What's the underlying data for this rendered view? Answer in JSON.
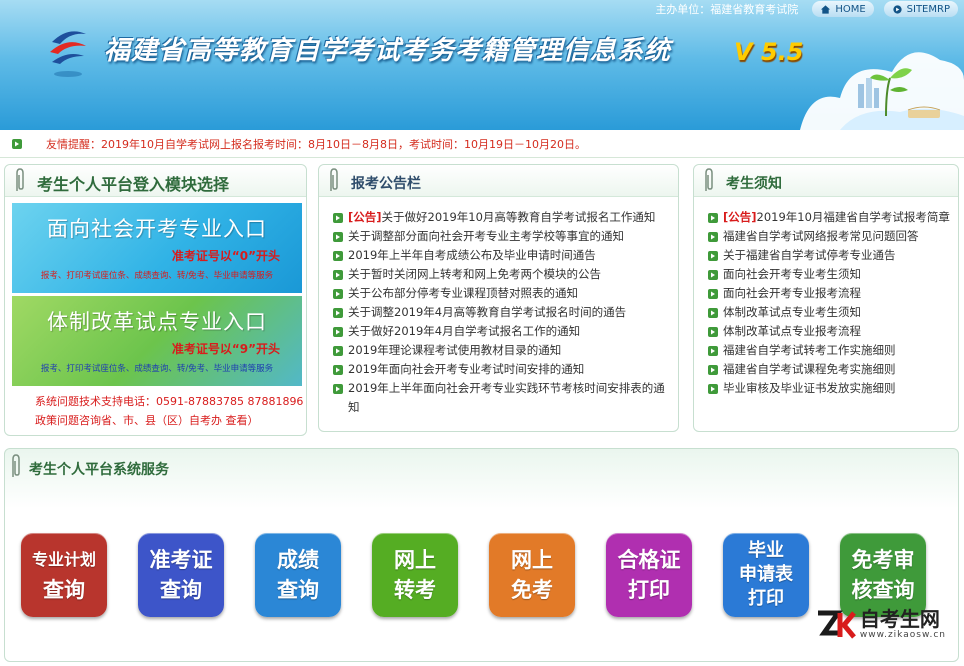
{
  "header": {
    "sponsor": "主办单位：福建省教育考试院",
    "home_label": "HOME",
    "sitemap_label": "SITEMRP",
    "title": "福建省高等教育自学考试考务考籍管理信息系统",
    "version": "V 5.5"
  },
  "notice": {
    "text": "友情提醒：2019年10月自学考试网上报名报考时间：8月10日－8月8日，考试时间：10月19日－10月20日。"
  },
  "login": {
    "title": "考生个人平台登入模块选择",
    "entry1": {
      "name": "面向社会开考专业入口",
      "note": "准考证号以“0”开头",
      "desc": "报考、打印考试座位条、成绩查询、转/免考、毕业申请等服务"
    },
    "entry2": {
      "name": "体制改革试点专业入口",
      "note": "准考证号以“9”开头",
      "desc": "报考、打印考试座位条、成绩查询、转/免考、毕业申请等服务"
    },
    "support_tech": "系统问题技术支持电话：0591-87883785 87881896",
    "support_policy": "政策问题咨询省、市、县（区）自考办 查看）"
  },
  "announcements": {
    "title": "报考公告栏",
    "tag": "[公告]",
    "items": [
      "关于做好2019年10月高等教育自学考试报名工作通知",
      "关于调整部分面向社会开考专业主考学校等事宜的通知",
      "2019年上半年自考成绩公布及毕业申请时间通告",
      "关于暂时关闭网上转考和网上免考两个模块的公告",
      "关于公布部分停考专业课程顶替对照表的通知",
      "关于调整2019年4月高等教育自学考试报名时间的通告",
      "关于做好2019年4月自学考试报名工作的通知",
      "2019年理论课程考试使用教材目录的通知",
      "2019年面向社会开考专业考试时间安排的通知",
      "2019年上半年面向社会开考专业实践环节考核时间安排表的通知"
    ]
  },
  "guide": {
    "title": "考生须知",
    "tag": "[公告]",
    "items": [
      "2019年10月福建省自学考试报考简章",
      "福建省自学考试网络报考常见问题回答",
      "关于福建省自学考试停考专业通告",
      "面向社会开考专业考生须知",
      "面向社会开考专业报考流程",
      "体制改革试点专业考生须知",
      "体制改革试点专业报考流程",
      "福建省自学考试转考工作实施细则",
      "福建省自学考试课程免考实施细则",
      "毕业审核及毕业证书发放实施细则"
    ]
  },
  "services": {
    "title": "考生个人平台系统服务",
    "buttons": [
      {
        "line1": "专业计划",
        "line2": "查询",
        "line3": "",
        "color": "#b8352d"
      },
      {
        "line1": "准考证",
        "line2": "查询",
        "line3": "",
        "color": "#3d55c9"
      },
      {
        "line1": "成绩",
        "line2": "查询",
        "line3": "",
        "color": "#2b87d6"
      },
      {
        "line1": "网上",
        "line2": "转考",
        "line3": "",
        "color": "#55ad23"
      },
      {
        "line1": "网上",
        "line2": "免考",
        "line3": "",
        "color": "#e27a28"
      },
      {
        "line1": "合格证",
        "line2": "打印",
        "line3": "",
        "color": "#b02fb0"
      },
      {
        "line1": "毕业",
        "line2": "申请表",
        "line3": "打印",
        "color": "#2b7ad6"
      },
      {
        "line1": "免考审",
        "line2": "核查询",
        "line3": "",
        "color": "#3f9a3a"
      }
    ]
  },
  "watermark": {
    "name": "自考生网",
    "url": "www.zikaosw.cn"
  }
}
